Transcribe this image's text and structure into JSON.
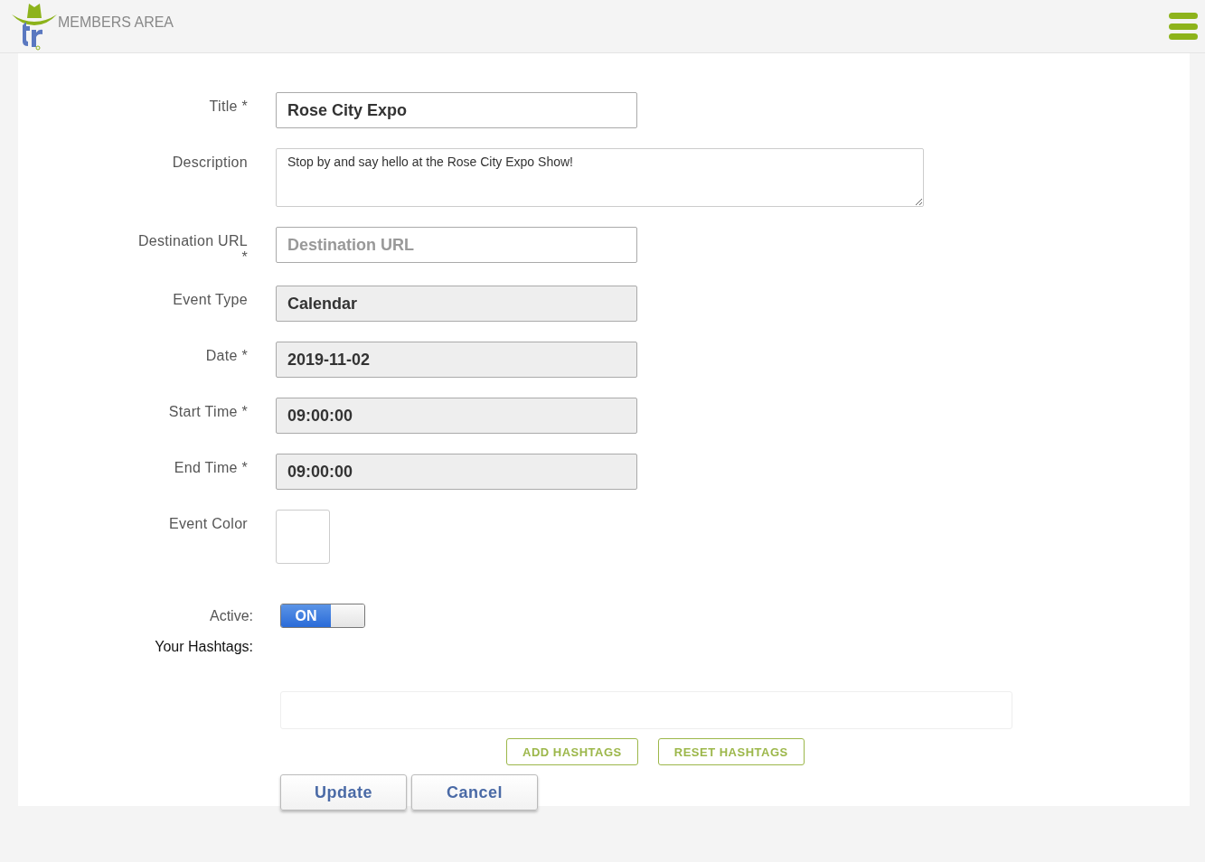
{
  "header": {
    "title": "MEMBERS AREA"
  },
  "fields": [
    {
      "kind": "text",
      "label": "Title *",
      "value": "Rose City Expo"
    },
    {
      "kind": "textarea",
      "label": "Description",
      "value": "Stop by and say hello at the Rose City Expo Show!"
    },
    {
      "kind": "text",
      "label": "Destination URL *",
      "placeholder": "Destination URL"
    },
    {
      "kind": "readonly",
      "label": "Event Type",
      "value": "Calendar"
    },
    {
      "kind": "readonly",
      "label": "Date *",
      "value": "2019-11-02"
    },
    {
      "kind": "readonly",
      "label": "Start Time *",
      "value": "09:00:00"
    },
    {
      "kind": "readonly",
      "label": "End Time *",
      "value": "09:00:00"
    },
    {
      "kind": "color",
      "label": "Event Color",
      "color": "#ffffff"
    }
  ],
  "active": {
    "label": "Active:",
    "on": true,
    "on_text": "ON"
  },
  "hashtags": {
    "label": "Your Hashtags:",
    "add_button": "ADD HASHTAGS",
    "reset_button": "RESET HASHTAGS"
  },
  "buttons": [
    "Update",
    "Cancel"
  ]
}
